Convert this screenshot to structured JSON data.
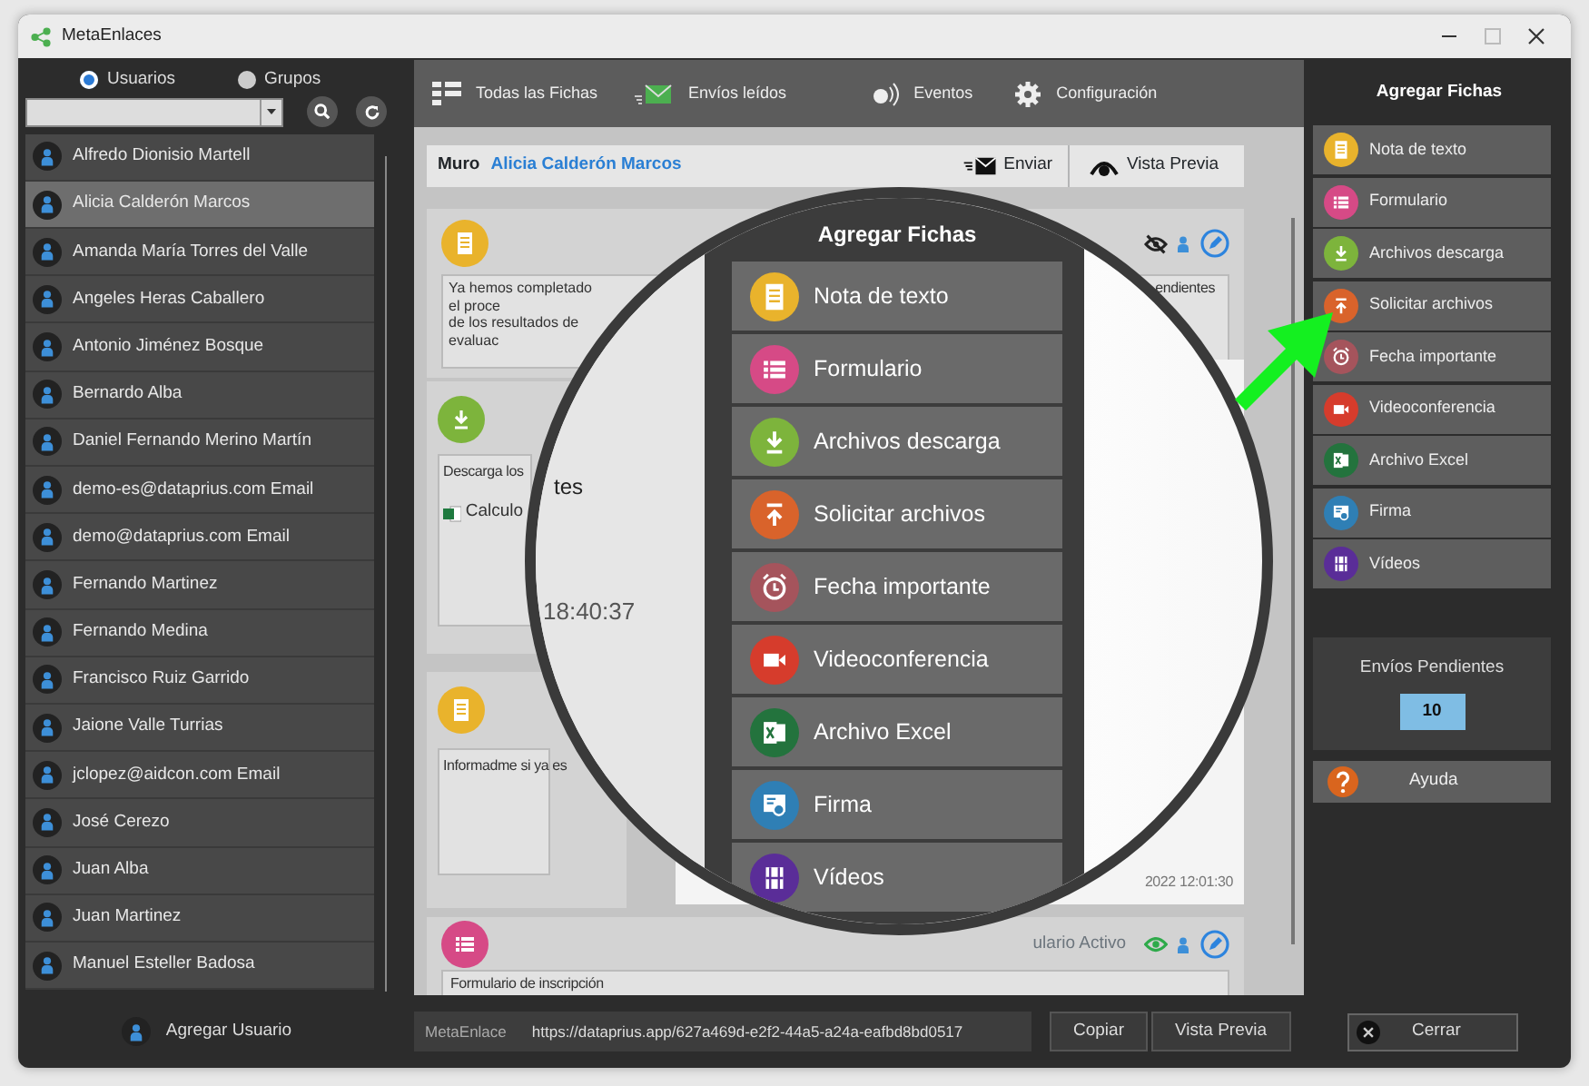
{
  "window": {
    "title": "MetaEnlaces"
  },
  "users_panel": {
    "filters": [
      {
        "label": "Usuarios",
        "selected": true
      },
      {
        "label": "Grupos",
        "selected": false
      }
    ],
    "users": [
      {
        "name": "Alfredo Dionisio Martell",
        "selected": false
      },
      {
        "name": "Alicia Calderón Marcos",
        "selected": true
      },
      {
        "name": "Amanda María Torres del Valle",
        "selected": false
      },
      {
        "name": "Angeles Heras Caballero",
        "selected": false
      },
      {
        "name": "Antonio Jiménez Bosque",
        "selected": false
      },
      {
        "name": "Bernardo Alba",
        "selected": false
      },
      {
        "name": "Daniel Fernando Merino Martín",
        "selected": false
      },
      {
        "name": "demo-es@dataprius.com Email",
        "selected": false
      },
      {
        "name": "demo@dataprius.com Email",
        "selected": false
      },
      {
        "name": "Fernando Martinez",
        "selected": false
      },
      {
        "name": "Fernando Medina",
        "selected": false
      },
      {
        "name": "Francisco Ruiz Garrido",
        "selected": false
      },
      {
        "name": "Jaione Valle Turrias",
        "selected": false
      },
      {
        "name": "jclopez@aidcon.com Email",
        "selected": false
      },
      {
        "name": "José Cerezo",
        "selected": false
      },
      {
        "name": "Juan Alba",
        "selected": false
      },
      {
        "name": "Juan Martinez",
        "selected": false
      },
      {
        "name": "Manuel Esteller Badosa",
        "selected": false
      }
    ],
    "add_user": "Agregar Usuario"
  },
  "toolbar": [
    {
      "label": "Todas las Fichas",
      "kind": "grid"
    },
    {
      "label": "Envíos leídos",
      "kind": "mail"
    },
    {
      "label": "Eventos",
      "kind": "speaker"
    },
    {
      "label": "Configuración",
      "kind": "gear"
    }
  ],
  "wall": {
    "title": "Muro",
    "user": "Alicia Calderón Marcos",
    "send": "Enviar",
    "preview": "Vista Previa",
    "top_card": {
      "kind": "note",
      "lines": [
        "Ya hemos completado el proce",
        "de los resultados de evaluac"
      ],
      "side_text": "endientes",
      "visible": false
    },
    "download_card": {
      "kind": "download",
      "text": "Descarga los",
      "file": "Calculo"
    },
    "info_card": {
      "kind": "note",
      "text": "Informadme si ya es"
    },
    "right_card": {
      "date": "2022 12:01:30"
    },
    "form_card": {
      "kind": "form",
      "status": "ulario Activo",
      "visible": true,
      "text": "Formulario de inscripción"
    }
  },
  "magnifier": {
    "title": "Agregar Fichas",
    "fragments": [
      "tes",
      "18:40:37"
    ],
    "items": [
      {
        "label": "Nota de texto",
        "kind": "note",
        "color": "#e9b32c"
      },
      {
        "label": "Formulario",
        "kind": "form",
        "color": "#d64a86"
      },
      {
        "label": "Archivos descarga",
        "kind": "download",
        "color": "#7db43c"
      },
      {
        "label": "Solicitar archivos",
        "kind": "upload",
        "color": "#d9632b"
      },
      {
        "label": "Fecha importante",
        "kind": "alarm",
        "color": "#a5545c"
      },
      {
        "label": "Videoconferencia",
        "kind": "video",
        "color": "#d63c2c"
      },
      {
        "label": "Archivo Excel",
        "kind": "excel",
        "color": "#23733d"
      },
      {
        "label": "Firma",
        "kind": "signature",
        "color": "#2f7fb5"
      },
      {
        "label": "Vídeos",
        "kind": "film",
        "color": "#5a2d98"
      }
    ]
  },
  "link_bar": {
    "label": "MetaEnlace",
    "url": "https://dataprius.app/627a469d-e2f2-44a5-a24a-eafbd8bd0517",
    "buttons": [
      "Copiar",
      "Vista Previa"
    ]
  },
  "side_panel": {
    "title": "Agregar Fichas",
    "items": [
      {
        "label": "Nota de texto",
        "kind": "note",
        "color": "#e9b32c"
      },
      {
        "label": "Formulario",
        "kind": "form",
        "color": "#d64a86"
      },
      {
        "label": "Archivos descarga",
        "kind": "download",
        "color": "#7db43c"
      },
      {
        "label": "Solicitar archivos",
        "kind": "upload",
        "color": "#d9632b"
      },
      {
        "label": "Fecha importante",
        "kind": "alarm",
        "color": "#a5545c"
      },
      {
        "label": "Videoconferencia",
        "kind": "video",
        "color": "#d63c2c"
      },
      {
        "label": "Archivo Excel",
        "kind": "excel",
        "color": "#23733d"
      },
      {
        "label": "Firma",
        "kind": "signature",
        "color": "#2f7fb5"
      },
      {
        "label": "Vídeos",
        "kind": "film",
        "color": "#5a2d98"
      }
    ],
    "pending": {
      "label": "Envíos Pendientes",
      "count": "10"
    },
    "help": "Ayuda",
    "close": "Cerrar"
  }
}
